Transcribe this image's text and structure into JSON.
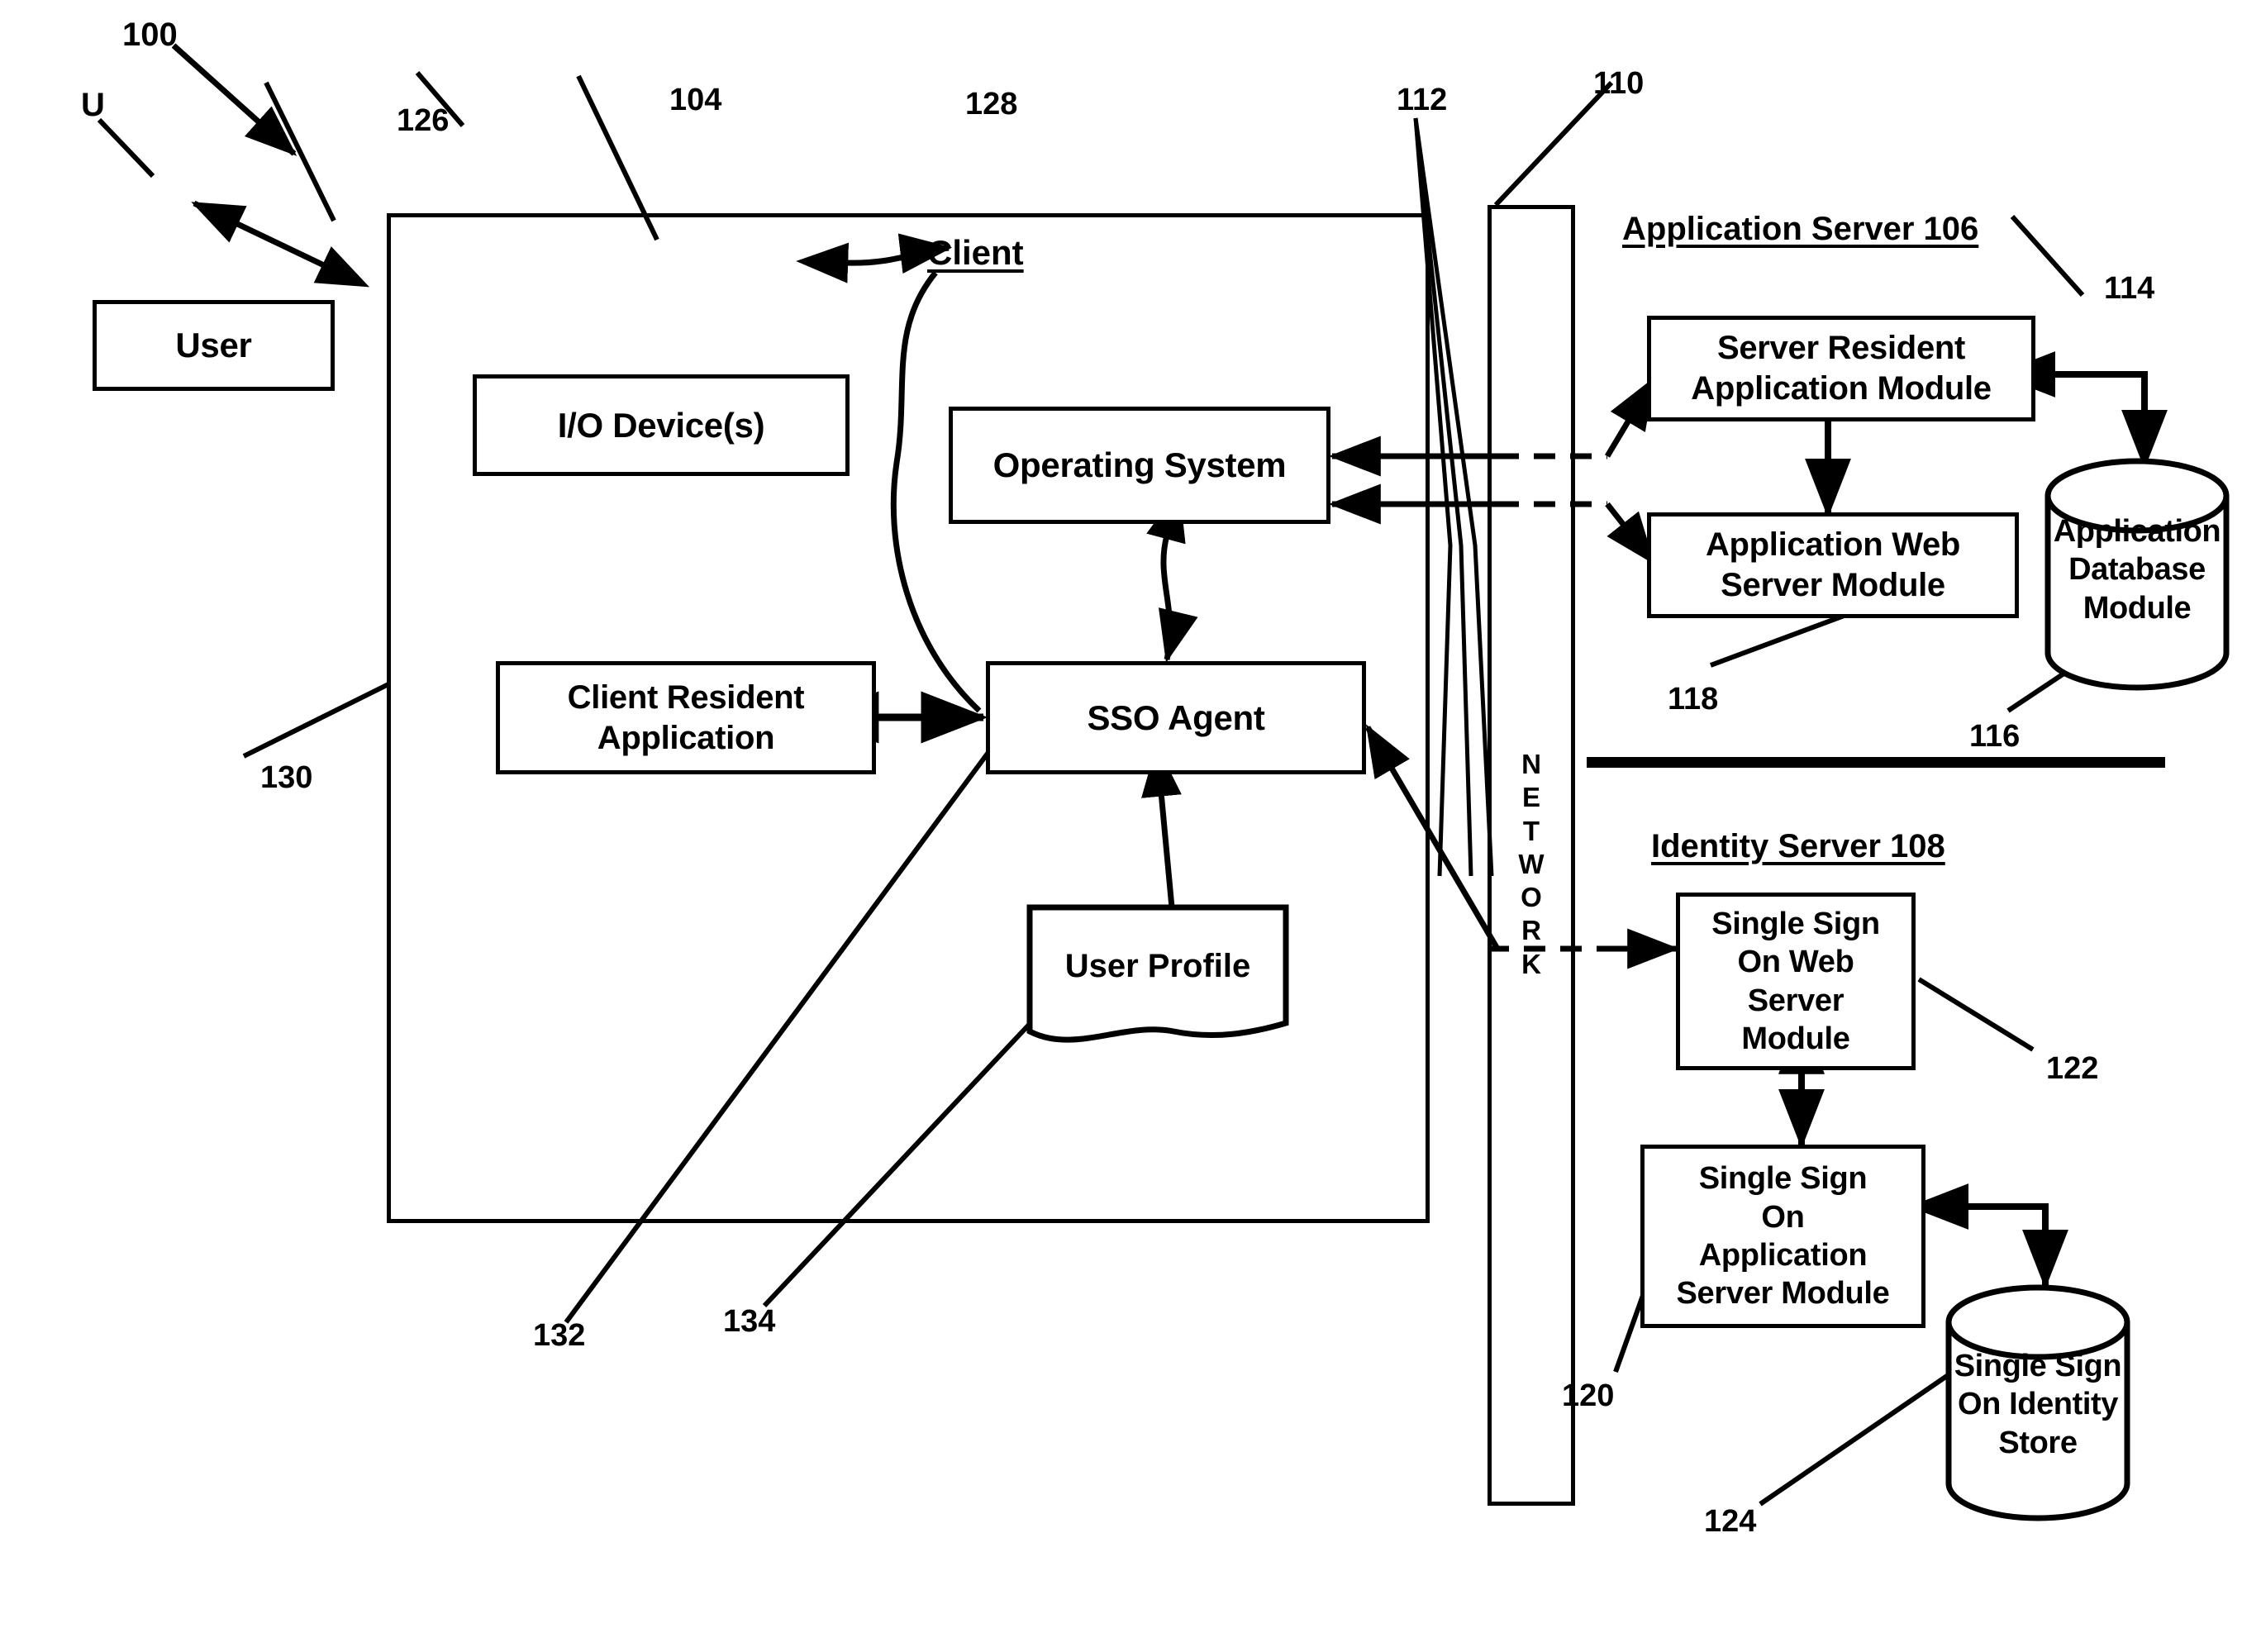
{
  "figure": {
    "system_numeral": "100",
    "user_numeral": "U"
  },
  "client": {
    "title": "Client",
    "numeral": "104",
    "boxes": {
      "io_device": {
        "label": "I/O Device(s)",
        "numeral": "126"
      },
      "operating_system": {
        "label": "Operating System",
        "numeral": "128"
      },
      "client_resident_application": {
        "label": "Client Resident Application",
        "line1": "Client Resident",
        "line2": "Application",
        "numeral": "130"
      },
      "sso_agent": {
        "label": "SSO Agent",
        "numeral": "132"
      },
      "user_profile": {
        "label": "User Profile",
        "numeral": "134"
      }
    }
  },
  "user": {
    "label": "User",
    "numeral": "U"
  },
  "network": {
    "label": "NETWORK",
    "letters": [
      "N",
      "E",
      "T",
      "W",
      "O",
      "R",
      "K"
    ],
    "numeral": "110",
    "connections_numeral": "112"
  },
  "application_server": {
    "title": "Application Server 106",
    "numeral": "106",
    "boxes": {
      "server_resident_application_module": {
        "line1": "Server Resident",
        "line2": "Application Module",
        "numeral": "114"
      },
      "application_web_server_module": {
        "line1": "Application Web",
        "line2": "Server Module",
        "numeral": "118"
      },
      "application_database_module": {
        "line1": "Application",
        "line2": "Database",
        "line3": "Module",
        "numeral": "116"
      }
    }
  },
  "identity_server": {
    "title": "Identity Server 108",
    "numeral": "108",
    "boxes": {
      "single_sign_on_web_server_module": {
        "line1": "Single Sign",
        "line2": "On Web",
        "line3": "Server",
        "line4": "Module",
        "numeral": "122"
      },
      "single_sign_on_application_server_module": {
        "line1": "Single Sign",
        "line2": "On",
        "line3": "Application",
        "line4": "Server Module",
        "numeral": "120"
      },
      "single_sign_on_identity_store": {
        "line1": "Single Sign",
        "line2": "On Identity",
        "line3": "Store",
        "numeral": "124"
      }
    }
  },
  "colors": {
    "ink": "#000000",
    "paper": "#ffffff"
  }
}
